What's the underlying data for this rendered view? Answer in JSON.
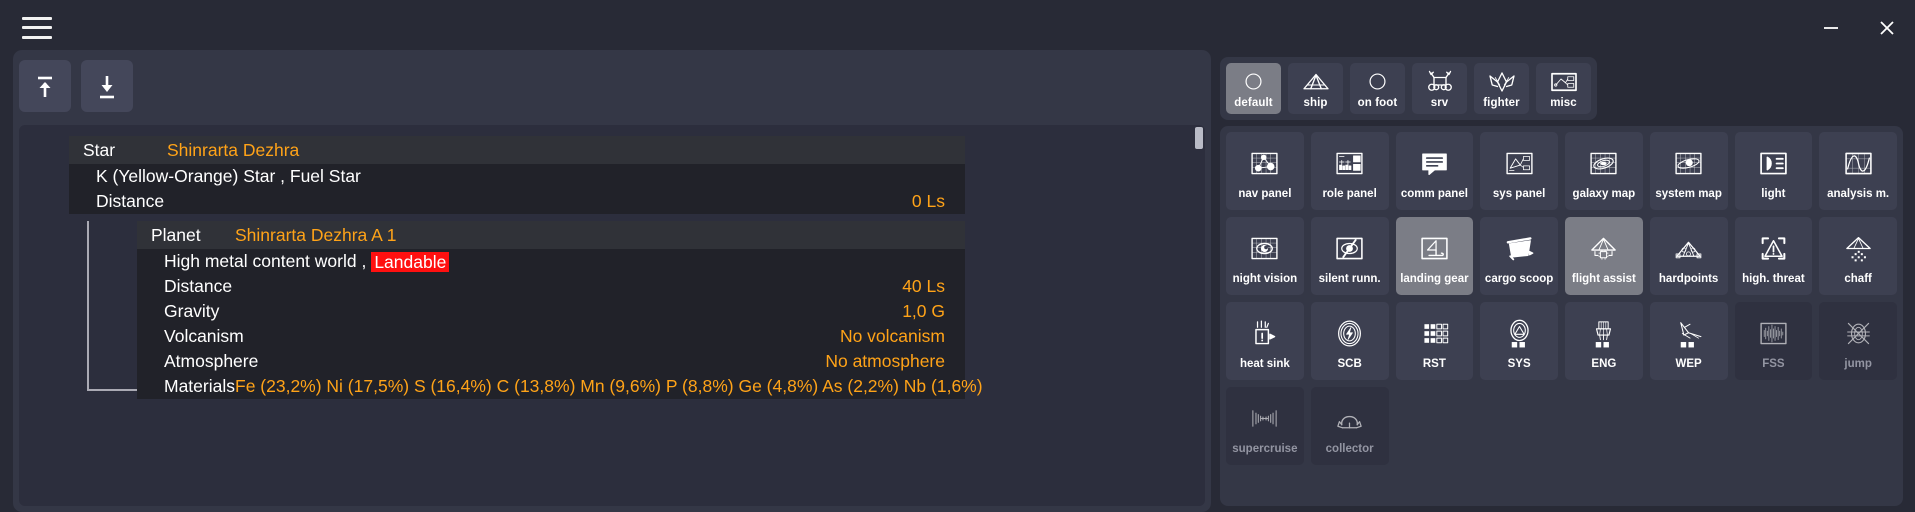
{
  "titlebar": {
    "menu_icon": "hamburger-icon",
    "minimize_label": "–",
    "close_label": "✕"
  },
  "left_panel": {
    "toolbar": [
      {
        "name": "collapse-all-button",
        "icon": "arrow-up-to-line-icon"
      },
      {
        "name": "expand-all-button",
        "icon": "arrow-down-to-line-icon"
      }
    ],
    "star": {
      "kind": "Star",
      "name": "Shinrarta Dezhra",
      "lines": [
        {
          "label": "K (Yellow-Orange) Star , Fuel Star",
          "value": ""
        },
        {
          "label": "Distance",
          "value": "0 Ls"
        }
      ]
    },
    "planet": {
      "kind": "Planet",
      "name": "Shinrarta Dezhra A 1",
      "type_text": "High metal content world ,",
      "tag": "Landable",
      "lines": [
        {
          "label": "Distance",
          "value": "40 Ls"
        },
        {
          "label": "Gravity",
          "value": "1,0 G"
        },
        {
          "label": "Volcanism",
          "value": "No volcanism"
        },
        {
          "label": "Atmosphere",
          "value": "No atmosphere"
        },
        {
          "label": "Materials",
          "value": "Fe (23,2%) Ni (17,5%) S (16,4%) C (13,8%) Mn (9,6%) P (8,8%) Ge (4,8%) As (2,2%) Nb (1,6%)"
        }
      ]
    }
  },
  "right_panel": {
    "categories": [
      {
        "label": "default",
        "icon": "circle-icon",
        "active": true
      },
      {
        "label": "ship",
        "icon": "ship-icon",
        "active": false
      },
      {
        "label": "on foot",
        "icon": "circle-icon",
        "active": false
      },
      {
        "label": "srv",
        "icon": "srv-icon",
        "active": false
      },
      {
        "label": "fighter",
        "icon": "fighter-icon",
        "active": false
      },
      {
        "label": "misc",
        "icon": "misc-panel-icon",
        "active": false
      }
    ],
    "bindings": [
      {
        "label": "nav panel",
        "icon": "nav-panel-icon",
        "state": "normal"
      },
      {
        "label": "role panel",
        "icon": "role-panel-icon",
        "state": "normal"
      },
      {
        "label": "comm panel",
        "icon": "comm-panel-icon",
        "state": "normal"
      },
      {
        "label": "sys panel",
        "icon": "sys-panel-icon",
        "state": "normal"
      },
      {
        "label": "galaxy map",
        "icon": "galaxy-map-icon",
        "state": "normal"
      },
      {
        "label": "system map",
        "icon": "system-map-icon",
        "state": "normal"
      },
      {
        "label": "light",
        "icon": "light-icon",
        "state": "normal"
      },
      {
        "label": "analysis m.",
        "icon": "analysis-mode-icon",
        "state": "normal"
      },
      {
        "label": "night vision",
        "icon": "night-vision-icon",
        "state": "normal"
      },
      {
        "label": "silent runn.",
        "icon": "silent-running-icon",
        "state": "normal"
      },
      {
        "label": "landing gear",
        "icon": "landing-gear-icon",
        "state": "active"
      },
      {
        "label": "cargo scoop",
        "icon": "cargo-scoop-icon",
        "state": "normal"
      },
      {
        "label": "flight assist",
        "icon": "flight-assist-icon",
        "state": "active"
      },
      {
        "label": "hardpoints",
        "icon": "hardpoints-icon",
        "state": "normal"
      },
      {
        "label": "high. threat",
        "icon": "high-threat-icon",
        "state": "normal"
      },
      {
        "label": "chaff",
        "icon": "chaff-icon",
        "state": "normal"
      },
      {
        "label": "heat sink",
        "icon": "heat-sink-icon",
        "state": "normal"
      },
      {
        "label": "SCB",
        "icon": "shield-cell-bank-icon",
        "state": "normal"
      },
      {
        "label": "RST",
        "icon": "reset-pips-icon",
        "state": "normal"
      },
      {
        "label": "SYS",
        "icon": "sys-pips-icon",
        "state": "normal"
      },
      {
        "label": "ENG",
        "icon": "eng-pips-icon",
        "state": "normal"
      },
      {
        "label": "WEP",
        "icon": "wep-pips-icon",
        "state": "normal"
      },
      {
        "label": "FSS",
        "icon": "fss-icon",
        "state": "dim"
      },
      {
        "label": "jump",
        "icon": "jump-icon",
        "state": "dim"
      },
      {
        "label": "supercruise",
        "icon": "supercruise-icon",
        "state": "dim"
      },
      {
        "label": "collector",
        "icon": "collector-limpet-icon",
        "state": "dim"
      }
    ]
  },
  "colors": {
    "accent_orange": "#ffa318",
    "landable_red": "#ff1010",
    "panel_bg": "#343746",
    "list_bg": "#2c2e3d",
    "window_bg": "#282a36"
  }
}
